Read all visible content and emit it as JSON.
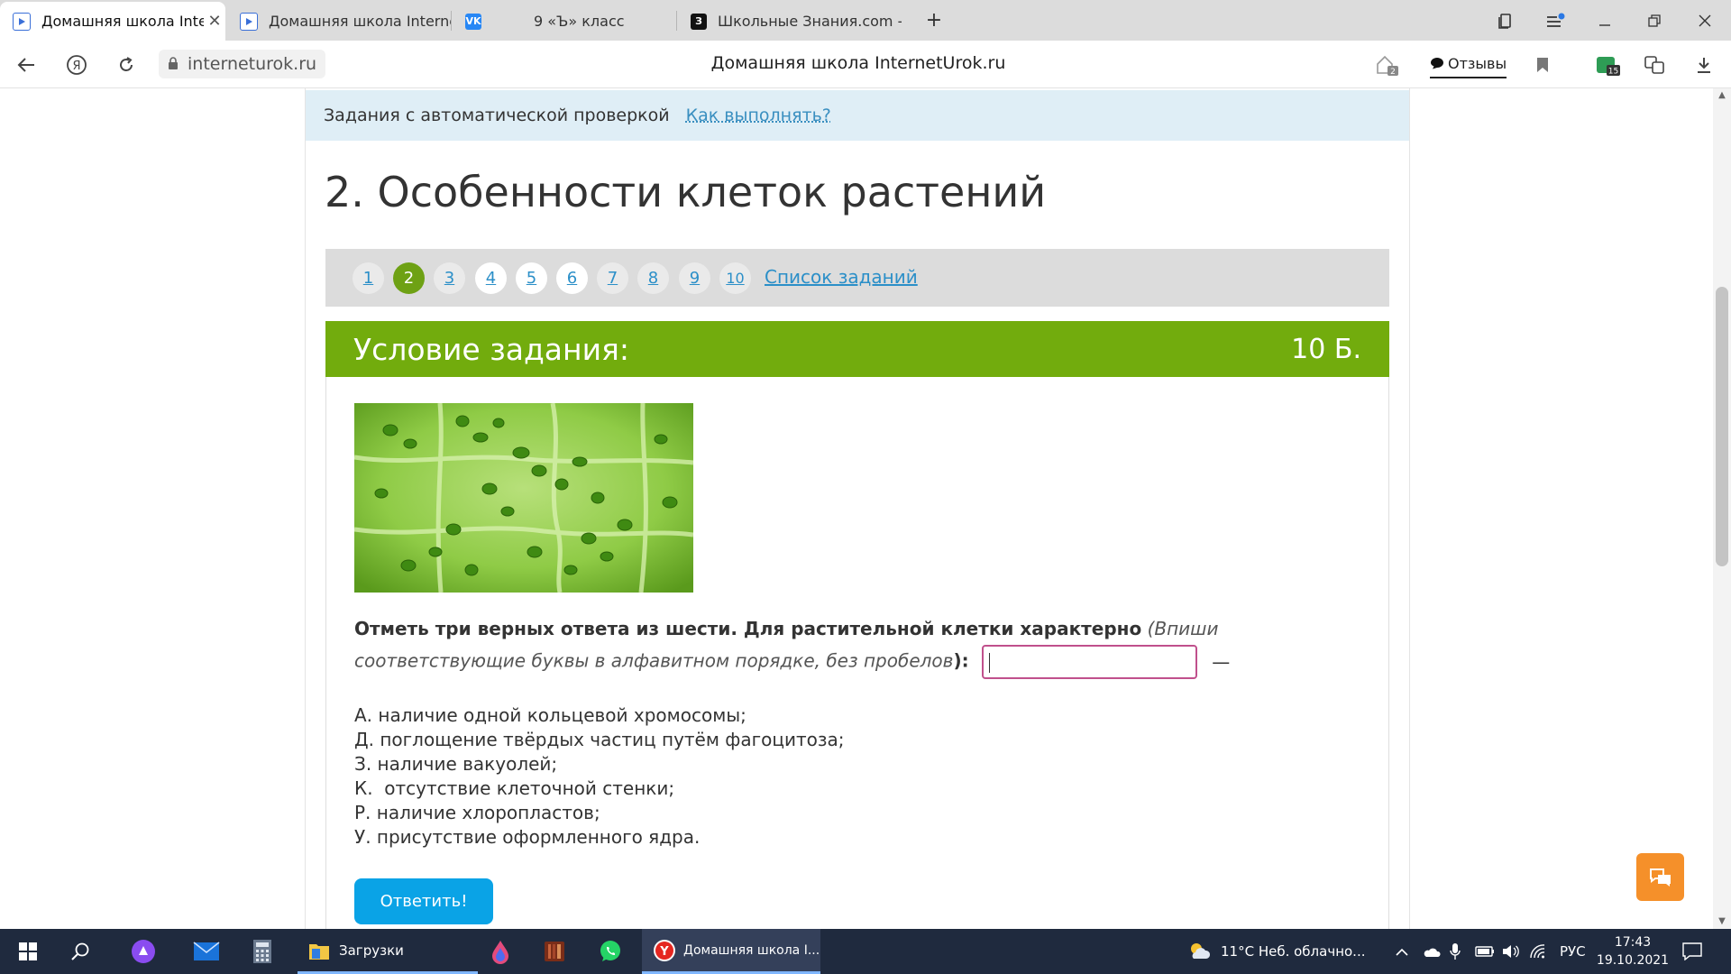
{
  "browser": {
    "tabs": [
      {
        "label": "Домашняя школа Interr",
        "active": true,
        "favicon": "play-icon"
      },
      {
        "label": "Домашняя школа Internet",
        "active": false,
        "favicon": "play-icon"
      },
      {
        "label": "9 «Ъ» класс",
        "active": false,
        "favicon": "vk-icon"
      },
      {
        "label": "Школьные Знания.com - F",
        "active": false,
        "favicon": "znaniya-icon"
      }
    ],
    "address": "interneturok.ru",
    "page_title": "Домашняя школа InternetUrok.ru",
    "reviews_label": "Отзывы",
    "badge_favorites": "2",
    "badge_ext": "15"
  },
  "page": {
    "autocheck_label": "Задания с автоматической проверкой",
    "howto_link": "Как выполнять?",
    "title": "2. Особенности клеток растений",
    "pager": {
      "pages": [
        "1",
        "2",
        "3",
        "4",
        "5",
        "6",
        "7",
        "8",
        "9",
        "10"
      ],
      "current": "2",
      "list_link": "Список заданий"
    },
    "condition": {
      "title": "Условие задания:",
      "points": "10 Б."
    },
    "question": {
      "bold": "Отметь три верных ответа из шести. Для растительной клетки характерно",
      "italic": "(Впиши соответствующие буквы в алфавитном порядке, без пробелов",
      "close": "):",
      "answer_value": "",
      "dash": "—"
    },
    "options": [
      "А. наличие одной кольцевой хромосомы;",
      "Д. поглощение твёрдых частиц путём фагоцитоза;",
      "З. наличие вакуолей;",
      "К.  отсутствие клеточной стенки;",
      "Р. наличие хлоропластов;",
      "У. присутствие оформленного ядра."
    ],
    "submit_label": "Ответить!"
  },
  "taskbar": {
    "downloads": "Загрузки",
    "browser_window": "Домашняя школа I...",
    "weather": "11°C  Неб. облачно...",
    "lang": "РУС",
    "time": "17:43",
    "date": "19.10.2021"
  },
  "colors": {
    "accent_green": "#72ac0d",
    "link_blue": "#2b8fc8",
    "submit_blue": "#0aa3e6",
    "input_border": "#c0508c",
    "chat_orange": "#f5902a"
  }
}
